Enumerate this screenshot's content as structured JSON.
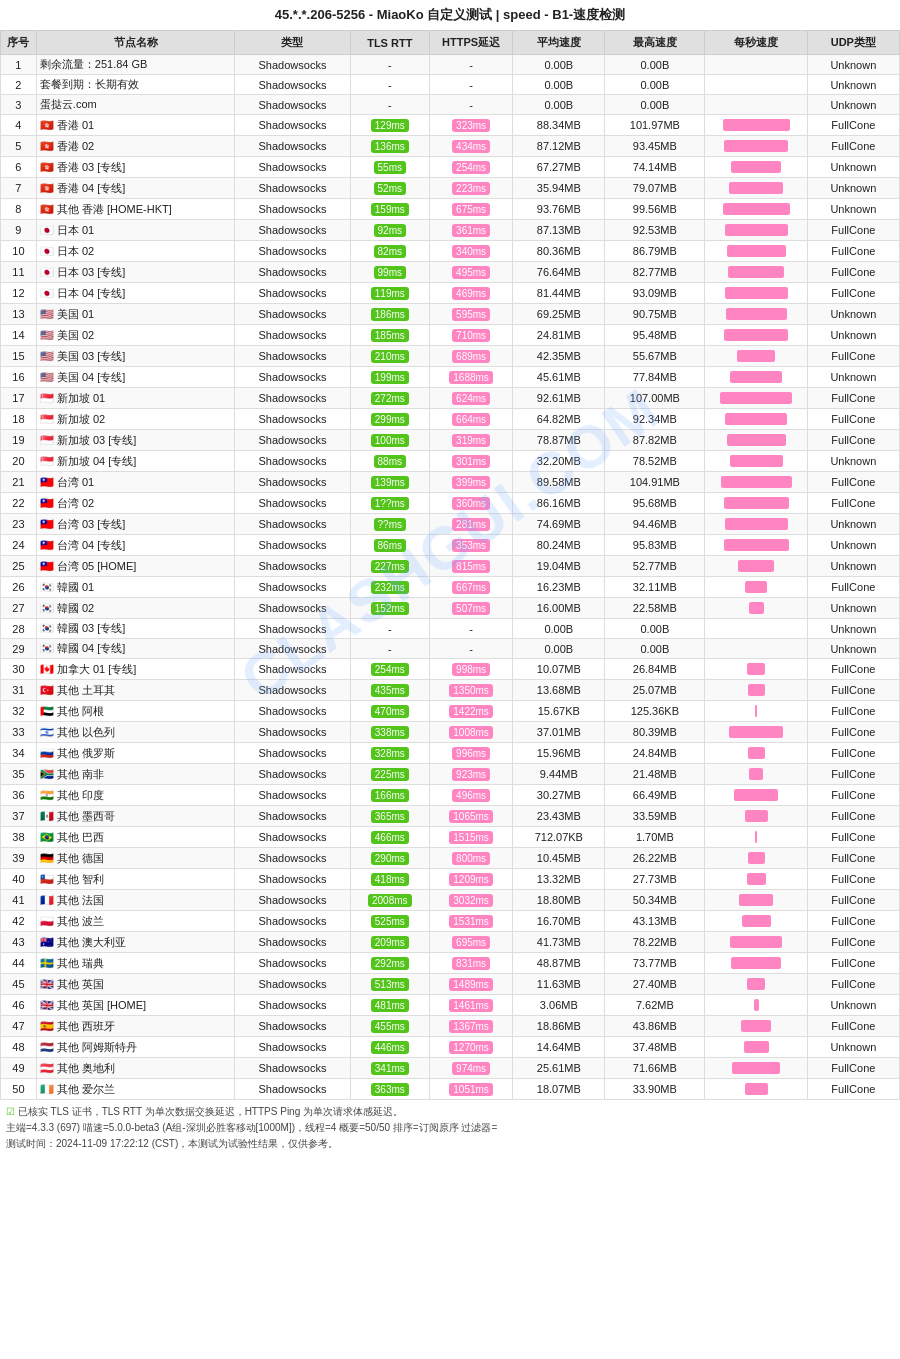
{
  "title": "45.*.*.206-5256 - MiaoKo 自定义测试 | speed - B1-速度检测",
  "watermark": "CLASHGUI.COM",
  "headers": [
    "序号",
    "节点名称",
    "类型",
    "TLS RTT",
    "HTTPS延迟",
    "平均速度",
    "最高速度",
    "每秒速度",
    "UDP类型"
  ],
  "rows": [
    [
      1,
      "剩余流量：251.84 GB",
      "Shadowsocks",
      "-",
      "-",
      "0.00B",
      "0.00B",
      0,
      "Unknown"
    ],
    [
      2,
      "套餐到期：长期有效",
      "Shadowsocks",
      "-",
      "-",
      "0.00B",
      "0.00B",
      0,
      "Unknown"
    ],
    [
      3,
      "蛋挞云.com",
      "Shadowsocks",
      "-",
      "-",
      "0.00B",
      "0.00B",
      0,
      "Unknown"
    ],
    [
      4,
      "🇭🇰 香港 01",
      "Shadowsocks",
      "129ms",
      "323ms",
      "88.34MB",
      "101.97MB",
      100,
      "FullCone"
    ],
    [
      5,
      "🇭🇰 香港 02",
      "Shadowsocks",
      "136ms",
      "434ms",
      "87.12MB",
      "93.45MB",
      95,
      "FullCone"
    ],
    [
      6,
      "🇭🇰 香港 03 [专线]",
      "Shadowsocks",
      "55ms",
      "254ms",
      "67.27MB",
      "74.14MB",
      75,
      "Unknown"
    ],
    [
      7,
      "🇭🇰 香港 04 [专线]",
      "Shadowsocks",
      "52ms",
      "223ms",
      "35.94MB",
      "79.07MB",
      80,
      "Unknown"
    ],
    [
      8,
      "🇭🇰 其他 香港 [HOME-HKT]",
      "Shadowsocks",
      "159ms",
      "675ms",
      "93.76MB",
      "99.56MB",
      99,
      "Unknown"
    ],
    [
      9,
      "🇯🇵 日本 01",
      "Shadowsocks",
      "92ms",
      "361ms",
      "87.13MB",
      "92.53MB",
      93,
      "FullCone"
    ],
    [
      10,
      "🇯🇵 日本 02",
      "Shadowsocks",
      "82ms",
      "340ms",
      "80.36MB",
      "86.79MB",
      87,
      "FullCone"
    ],
    [
      11,
      "🇯🇵 日本 03 [专线]",
      "Shadowsocks",
      "99ms",
      "495ms",
      "76.64MB",
      "82.77MB",
      83,
      "FullCone"
    ],
    [
      12,
      "🇯🇵 日本 04 [专线]",
      "Shadowsocks",
      "119ms",
      "469ms",
      "81.44MB",
      "93.09MB",
      93,
      "FullCone"
    ],
    [
      13,
      "🇺🇸 美国 01",
      "Shadowsocks",
      "186ms",
      "595ms",
      "69.25MB",
      "90.75MB",
      91,
      "Unknown"
    ],
    [
      14,
      "🇺🇸 美国 02",
      "Shadowsocks",
      "185ms",
      "710ms",
      "24.81MB",
      "95.48MB",
      95,
      "Unknown"
    ],
    [
      15,
      "🇺🇸 美国 03 [专线]",
      "Shadowsocks",
      "210ms",
      "689ms",
      "42.35MB",
      "55.67MB",
      56,
      "FullCone"
    ],
    [
      16,
      "🇺🇸 美国 04 [专线]",
      "Shadowsocks",
      "199ms",
      "1688ms",
      "45.61MB",
      "77.84MB",
      78,
      "Unknown"
    ],
    [
      17,
      "🇸🇬 新加坡 01",
      "Shadowsocks",
      "272ms",
      "624ms",
      "92.61MB",
      "107.00MB",
      107,
      "FullCone"
    ],
    [
      18,
      "🇸🇬 新加坡 02",
      "Shadowsocks",
      "299ms",
      "664ms",
      "64.82MB",
      "92.34MB",
      92,
      "FullCone"
    ],
    [
      19,
      "🇸🇬 新加坡 03 [专线]",
      "Shadowsocks",
      "100ms",
      "319ms",
      "78.87MB",
      "87.82MB",
      88,
      "FullCone"
    ],
    [
      20,
      "🇸🇬 新加坡 04 [专线]",
      "Shadowsocks",
      "88ms",
      "301ms",
      "32.20MB",
      "78.52MB",
      79,
      "Unknown"
    ],
    [
      21,
      "🇹🇼 台湾 01",
      "Shadowsocks",
      "139ms",
      "399ms",
      "89.58MB",
      "104.91MB",
      105,
      "FullCone"
    ],
    [
      22,
      "🇹🇼 台湾 02",
      "Shadowsocks",
      "1??ms",
      "360ms",
      "86.16MB",
      "95.68MB",
      96,
      "FullCone"
    ],
    [
      23,
      "🇹🇼 台湾 03 [专线]",
      "Shadowsocks",
      "??ms",
      "281ms",
      "74.69MB",
      "94.46MB",
      94,
      "Unknown"
    ],
    [
      24,
      "🇹🇼 台湾 04 [专线]",
      "Shadowsocks",
      "86ms",
      "353ms",
      "80.24MB",
      "95.83MB",
      96,
      "Unknown"
    ],
    [
      25,
      "🇹🇼 台湾 05 [HOME]",
      "Shadowsocks",
      "227ms",
      "815ms",
      "19.04MB",
      "52.77MB",
      53,
      "Unknown"
    ],
    [
      26,
      "🇰🇷 韓國 01",
      "Shadowsocks",
      "232ms",
      "667ms",
      "16.23MB",
      "32.11MB",
      32,
      "FullCone"
    ],
    [
      27,
      "🇰🇷 韓國 02",
      "Shadowsocks",
      "152ms",
      "507ms",
      "16.00MB",
      "22.58MB",
      23,
      "Unknown"
    ],
    [
      28,
      "🇰🇷 韓國 03 [专线]",
      "Shadowsocks",
      "-",
      "-",
      "0.00B",
      "0.00B",
      0,
      "Unknown"
    ],
    [
      29,
      "🇰🇷 韓國 04 [专线]",
      "Shadowsocks",
      "-",
      "-",
      "0.00B",
      "0.00B",
      0,
      "Unknown"
    ],
    [
      30,
      "🇨🇦 加拿大 01 [专线]",
      "Shadowsocks",
      "254ms",
      "998ms",
      "10.07MB",
      "26.84MB",
      27,
      "FullCone"
    ],
    [
      31,
      "🇹🇷 其他 土耳其",
      "Shadowsocks",
      "435ms",
      "1350ms",
      "13.68MB",
      "25.07MB",
      25,
      "FullCone"
    ],
    [
      32,
      "🇦🇪 其他 阿根",
      "Shadowsocks",
      "470ms",
      "1422ms",
      "15.67KB",
      "125.36KB",
      2,
      "FullCone"
    ],
    [
      33,
      "🇮🇱 其他 以色列",
      "Shadowsocks",
      "338ms",
      "1008ms",
      "37.01MB",
      "80.39MB",
      80,
      "FullCone"
    ],
    [
      34,
      "🇷🇺 其他 俄罗斯",
      "Shadowsocks",
      "328ms",
      "996ms",
      "15.96MB",
      "24.84MB",
      25,
      "FullCone"
    ],
    [
      35,
      "🇿🇦 其他 南非",
      "Shadowsocks",
      "225ms",
      "923ms",
      "9.44MB",
      "21.48MB",
      21,
      "FullCone"
    ],
    [
      36,
      "🇮🇳 其他 印度",
      "Shadowsocks",
      "166ms",
      "496ms",
      "30.27MB",
      "66.49MB",
      66,
      "FullCone"
    ],
    [
      37,
      "🇲🇽 其他 墨西哥",
      "Shadowsocks",
      "365ms",
      "1065ms",
      "23.43MB",
      "33.59MB",
      34,
      "FullCone"
    ],
    [
      38,
      "🇧🇷 其他 巴西",
      "Shadowsocks",
      "466ms",
      "1515ms",
      "712.07KB",
      "1.70MB",
      2,
      "FullCone"
    ],
    [
      39,
      "🇩🇪 其他 德国",
      "Shadowsocks",
      "290ms",
      "800ms",
      "10.45MB",
      "26.22MB",
      26,
      "FullCone"
    ],
    [
      40,
      "🇨🇱 其他 智利",
      "Shadowsocks",
      "418ms",
      "1209ms",
      "13.32MB",
      "27.73MB",
      28,
      "FullCone"
    ],
    [
      41,
      "🇫🇷 其他 法国",
      "Shadowsocks",
      "2008ms",
      "3032ms",
      "18.80MB",
      "50.34MB",
      50,
      "FullCone"
    ],
    [
      42,
      "🇵🇱 其他 波兰",
      "Shadowsocks",
      "525ms",
      "1531ms",
      "16.70MB",
      "43.13MB",
      43,
      "FullCone"
    ],
    [
      43,
      "🇦🇺 其他 澳大利亚",
      "Shadowsocks",
      "209ms",
      "695ms",
      "41.73MB",
      "78.22MB",
      78,
      "FullCone"
    ],
    [
      44,
      "🇸🇪 其他 瑞典",
      "Shadowsocks",
      "292ms",
      "831ms",
      "48.87MB",
      "73.77MB",
      74,
      "FullCone"
    ],
    [
      45,
      "🇬🇧 其他 英国",
      "Shadowsocks",
      "513ms",
      "1489ms",
      "11.63MB",
      "27.40MB",
      27,
      "FullCone"
    ],
    [
      46,
      "🇬🇧 其他 英国 [HOME]",
      "Shadowsocks",
      "481ms",
      "1461ms",
      "3.06MB",
      "7.62MB",
      8,
      "Unknown"
    ],
    [
      47,
      "🇪🇸 其他 西班牙",
      "Shadowsocks",
      "455ms",
      "1367ms",
      "18.86MB",
      "43.86MB",
      44,
      "FullCone"
    ],
    [
      48,
      "🇳🇱 其他 阿姆斯特丹",
      "Shadowsocks",
      "446ms",
      "1270ms",
      "14.64MB",
      "37.48MB",
      37,
      "Unknown"
    ],
    [
      49,
      "🇦🇹 其他 奥地利",
      "Shadowsocks",
      "341ms",
      "974ms",
      "25.61MB",
      "71.66MB",
      72,
      "FullCone"
    ],
    [
      50,
      "🇮🇪 其他 爱尔兰",
      "Shadowsocks",
      "363ms",
      "1051ms",
      "18.07MB",
      "33.90MB",
      34,
      "FullCone"
    ]
  ],
  "footer": [
    "☑ 已核实 TLS 证书，TLS RTT 为单次数据交换延迟，HTTPS Ping 为单次请求体感延迟。",
    "主端=4.3.3 (697) 喵速=5.0.0-beta3 (A组-深圳必胜客移动[1000M])，线程=4 概要=50/50 排序=订阅原序 过滤器=",
    "测试时间：2024-11-09 17:22:12 (CST)，本测试为试验性结果，仅供参考。"
  ]
}
